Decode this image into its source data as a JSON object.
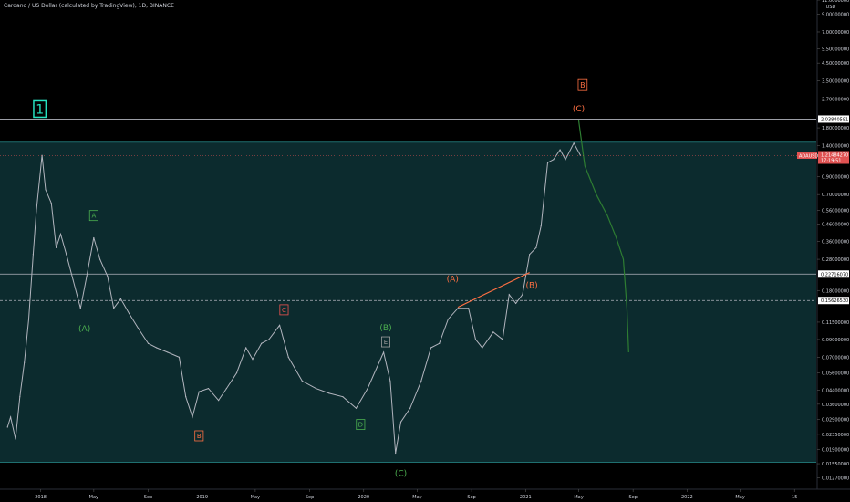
{
  "header": {
    "title": "Cardano / US Dollar (calculated by TradingView), 1D, BINANCE",
    "unit": "USD"
  },
  "colors": {
    "background": "#000000",
    "zone_fill": "#0c2b2e",
    "zone_line": "#1f6f6f",
    "price_line": "#b2b5be",
    "orange": "#ff7043",
    "teal_label": "#26e0c0",
    "green": "#2e7d32",
    "green_label": "#4caf50",
    "red_label": "#ef5350",
    "price_tag_bg": "#e05252"
  },
  "chart_data": {
    "type": "line",
    "title": "Cardano / US Dollar (calculated by TradingView), 1D, BINANCE",
    "scale": "log",
    "ylim": [
      0.0108,
      11.0
    ],
    "y_ticks": [
      {
        "value": 11.0,
        "label": "11.0000000"
      },
      {
        "value": 9.0,
        "label": "9.00000000"
      },
      {
        "value": 7.0,
        "label": "7.00000000"
      },
      {
        "value": 5.5,
        "label": "5.50000000"
      },
      {
        "value": 4.5,
        "label": "4.50000000"
      },
      {
        "value": 3.5,
        "label": "3.50000000"
      },
      {
        "value": 2.7,
        "label": "2.70000000"
      },
      {
        "value": 1.8,
        "label": "1.80000000"
      },
      {
        "value": 1.4,
        "label": "1.40000000"
      },
      {
        "value": 0.9,
        "label": "0.90000000"
      },
      {
        "value": 0.7,
        "label": "0.70000000"
      },
      {
        "value": 0.56,
        "label": "0.56000000"
      },
      {
        "value": 0.46,
        "label": "0.46000000"
      },
      {
        "value": 0.36,
        "label": "0.36000000"
      },
      {
        "value": 0.28,
        "label": "0.28000000"
      },
      {
        "value": 0.18,
        "label": "0.18000000"
      },
      {
        "value": 0.115,
        "label": "0.11500000"
      },
      {
        "value": 0.09,
        "label": "0.09000000"
      },
      {
        "value": 0.07,
        "label": "0.07000000"
      },
      {
        "value": 0.056,
        "label": "0.05600000"
      },
      {
        "value": 0.044,
        "label": "0.04400000"
      },
      {
        "value": 0.036,
        "label": "0.03600000"
      },
      {
        "value": 0.029,
        "label": "0.02900000"
      },
      {
        "value": 0.0235,
        "label": "0.02350000"
      },
      {
        "value": 0.019,
        "label": "0.01900000"
      },
      {
        "value": 0.0155,
        "label": "0.01550000"
      },
      {
        "value": 0.0127,
        "label": "0.01270000"
      }
    ],
    "x_ticks": [
      {
        "date": "2018-01-01",
        "label": "2018"
      },
      {
        "date": "2018-05-01",
        "label": "May"
      },
      {
        "date": "2018-09-01",
        "label": "Sep"
      },
      {
        "date": "2019-01-01",
        "label": "2019"
      },
      {
        "date": "2019-05-01",
        "label": "May"
      },
      {
        "date": "2019-09-01",
        "label": "Sep"
      },
      {
        "date": "2020-01-01",
        "label": "2020"
      },
      {
        "date": "2020-05-01",
        "label": "May"
      },
      {
        "date": "2020-09-01",
        "label": "Sep"
      },
      {
        "date": "2021-01-01",
        "label": "2021"
      },
      {
        "date": "2021-05-01",
        "label": "May"
      },
      {
        "date": "2021-09-01",
        "label": "Sep"
      },
      {
        "date": "2022-01-01",
        "label": "2022"
      },
      {
        "date": "2022-05-01",
        "label": "May"
      },
      {
        "date": "2022-09-01",
        "label": "15"
      }
    ],
    "series": [
      {
        "type": "line",
        "points": [
          {
            "x": "2017-10-18",
            "y": 0.026
          },
          {
            "x": "2017-10-25",
            "y": 0.03
          },
          {
            "x": "2017-11-05",
            "y": 0.022
          },
          {
            "x": "2017-11-15",
            "y": 0.04
          },
          {
            "x": "2017-11-25",
            "y": 0.065
          },
          {
            "x": "2017-12-05",
            "y": 0.12
          },
          {
            "x": "2017-12-15",
            "y": 0.3
          },
          {
            "x": "2017-12-22",
            "y": 0.55
          },
          {
            "x": "2018-01-04",
            "y": 1.22
          },
          {
            "x": "2018-01-12",
            "y": 0.75
          },
          {
            "x": "2018-01-25",
            "y": 0.62
          },
          {
            "x": "2018-02-05",
            "y": 0.33
          },
          {
            "x": "2018-02-15",
            "y": 0.4
          },
          {
            "x": "2018-02-28",
            "y": 0.3
          },
          {
            "x": "2018-03-15",
            "y": 0.21
          },
          {
            "x": "2018-04-01",
            "y": 0.14
          },
          {
            "x": "2018-04-15",
            "y": 0.22
          },
          {
            "x": "2018-05-01",
            "y": 0.38
          },
          {
            "x": "2018-05-15",
            "y": 0.28
          },
          {
            "x": "2018-06-01",
            "y": 0.22
          },
          {
            "x": "2018-06-15",
            "y": 0.14
          },
          {
            "x": "2018-07-01",
            "y": 0.16
          },
          {
            "x": "2018-07-20",
            "y": 0.13
          },
          {
            "x": "2018-08-10",
            "y": 0.105
          },
          {
            "x": "2018-09-01",
            "y": 0.085
          },
          {
            "x": "2018-09-20",
            "y": 0.08
          },
          {
            "x": "2018-10-15",
            "y": 0.075
          },
          {
            "x": "2018-11-10",
            "y": 0.07
          },
          {
            "x": "2018-11-25",
            "y": 0.04
          },
          {
            "x": "2018-12-10",
            "y": 0.03
          },
          {
            "x": "2018-12-25",
            "y": 0.043
          },
          {
            "x": "2019-01-15",
            "y": 0.045
          },
          {
            "x": "2019-02-07",
            "y": 0.038
          },
          {
            "x": "2019-02-25",
            "y": 0.045
          },
          {
            "x": "2019-03-20",
            "y": 0.056
          },
          {
            "x": "2019-04-10",
            "y": 0.08
          },
          {
            "x": "2019-04-25",
            "y": 0.068
          },
          {
            "x": "2019-05-15",
            "y": 0.085
          },
          {
            "x": "2019-06-01",
            "y": 0.09
          },
          {
            "x": "2019-06-25",
            "y": 0.11
          },
          {
            "x": "2019-07-15",
            "y": 0.07
          },
          {
            "x": "2019-08-15",
            "y": 0.05
          },
          {
            "x": "2019-09-15",
            "y": 0.045
          },
          {
            "x": "2019-10-15",
            "y": 0.042
          },
          {
            "x": "2019-11-15",
            "y": 0.04
          },
          {
            "x": "2019-12-15",
            "y": 0.034
          },
          {
            "x": "2020-01-10",
            "y": 0.045
          },
          {
            "x": "2020-02-15",
            "y": 0.075
          },
          {
            "x": "2020-03-01",
            "y": 0.05
          },
          {
            "x": "2020-03-13",
            "y": 0.018
          },
          {
            "x": "2020-03-25",
            "y": 0.028
          },
          {
            "x": "2020-04-15",
            "y": 0.034
          },
          {
            "x": "2020-05-10",
            "y": 0.05
          },
          {
            "x": "2020-06-01",
            "y": 0.08
          },
          {
            "x": "2020-06-20",
            "y": 0.085
          },
          {
            "x": "2020-07-10",
            "y": 0.12
          },
          {
            "x": "2020-08-01",
            "y": 0.14
          },
          {
            "x": "2020-08-25",
            "y": 0.14
          },
          {
            "x": "2020-09-10",
            "y": 0.09
          },
          {
            "x": "2020-09-25",
            "y": 0.08
          },
          {
            "x": "2020-10-20",
            "y": 0.1
          },
          {
            "x": "2020-11-10",
            "y": 0.09
          },
          {
            "x": "2020-11-25",
            "y": 0.17
          },
          {
            "x": "2020-12-10",
            "y": 0.15
          },
          {
            "x": "2020-12-25",
            "y": 0.17
          },
          {
            "x": "2021-01-10",
            "y": 0.3
          },
          {
            "x": "2021-01-25",
            "y": 0.33
          },
          {
            "x": "2021-02-05",
            "y": 0.45
          },
          {
            "x": "2021-02-20",
            "y": 1.1
          },
          {
            "x": "2021-03-05",
            "y": 1.15
          },
          {
            "x": "2021-03-20",
            "y": 1.32
          },
          {
            "x": "2021-04-01",
            "y": 1.15
          },
          {
            "x": "2021-04-20",
            "y": 1.45
          },
          {
            "x": "2021-05-05",
            "y": 1.22
          }
        ]
      }
    ],
    "projection": [
      {
        "x": "2021-05-01",
        "y": 2.0
      },
      {
        "x": "2021-05-15",
        "y": 1.05
      },
      {
        "x": "2021-06-10",
        "y": 0.7
      },
      {
        "x": "2021-07-05",
        "y": 0.52
      },
      {
        "x": "2021-07-25",
        "y": 0.38
      },
      {
        "x": "2021-08-10",
        "y": 0.28
      },
      {
        "x": "2021-08-18",
        "y": 0.14
      },
      {
        "x": "2021-08-22",
        "y": 0.075
      }
    ],
    "trendline": [
      {
        "x": "2020-08-01",
        "y": 0.142
      },
      {
        "x": "2021-01-10",
        "y": 0.232
      }
    ],
    "zone": {
      "top": 1.47,
      "bottom": 0.0158
    },
    "horizontal_lines": [
      {
        "y": 2.03840591,
        "label": "2.03840591"
      },
      {
        "y": 0.2271607,
        "label": "0.22716070"
      },
      {
        "y": 0.1562653,
        "label": "0.15626530",
        "dashed": true
      }
    ],
    "current_price": {
      "y": 1.2148427,
      "symbol": "ADAUSD",
      "label": "1.21484270",
      "countdown": "17:19:51"
    },
    "annotations": [
      {
        "text": "1",
        "x": "2017-12-30",
        "y": 2.35,
        "style": "teal_box"
      },
      {
        "text": "A",
        "x": "2018-05-01",
        "y": 0.52,
        "style": "green_box"
      },
      {
        "text": "(A)",
        "x": "2018-04-10",
        "y": 0.105,
        "style": "green_text"
      },
      {
        "text": "B",
        "x": "2018-12-25",
        "y": 0.023,
        "style": "orange_box"
      },
      {
        "text": "C",
        "x": "2019-07-05",
        "y": 0.137,
        "style": "red_box"
      },
      {
        "text": "(B)",
        "x": "2020-02-20",
        "y": 0.107,
        "style": "green_text"
      },
      {
        "text": "E",
        "x": "2020-02-20",
        "y": 0.087,
        "style": "grey_box"
      },
      {
        "text": "D",
        "x": "2019-12-25",
        "y": 0.027,
        "style": "green_box"
      },
      {
        "text": "(C)",
        "x": "2020-03-25",
        "y": 0.0136,
        "style": "green_text"
      },
      {
        "text": "(A)",
        "x": "2020-07-20",
        "y": 0.213,
        "style": "orange_text"
      },
      {
        "text": "(B)",
        "x": "2021-01-15",
        "y": 0.195,
        "style": "orange_text"
      },
      {
        "text": "B",
        "x": "2021-05-10",
        "y": 3.3,
        "style": "orange_box"
      },
      {
        "text": "(C)",
        "x": "2021-05-01",
        "y": 2.37,
        "style": "orange_text"
      }
    ]
  }
}
